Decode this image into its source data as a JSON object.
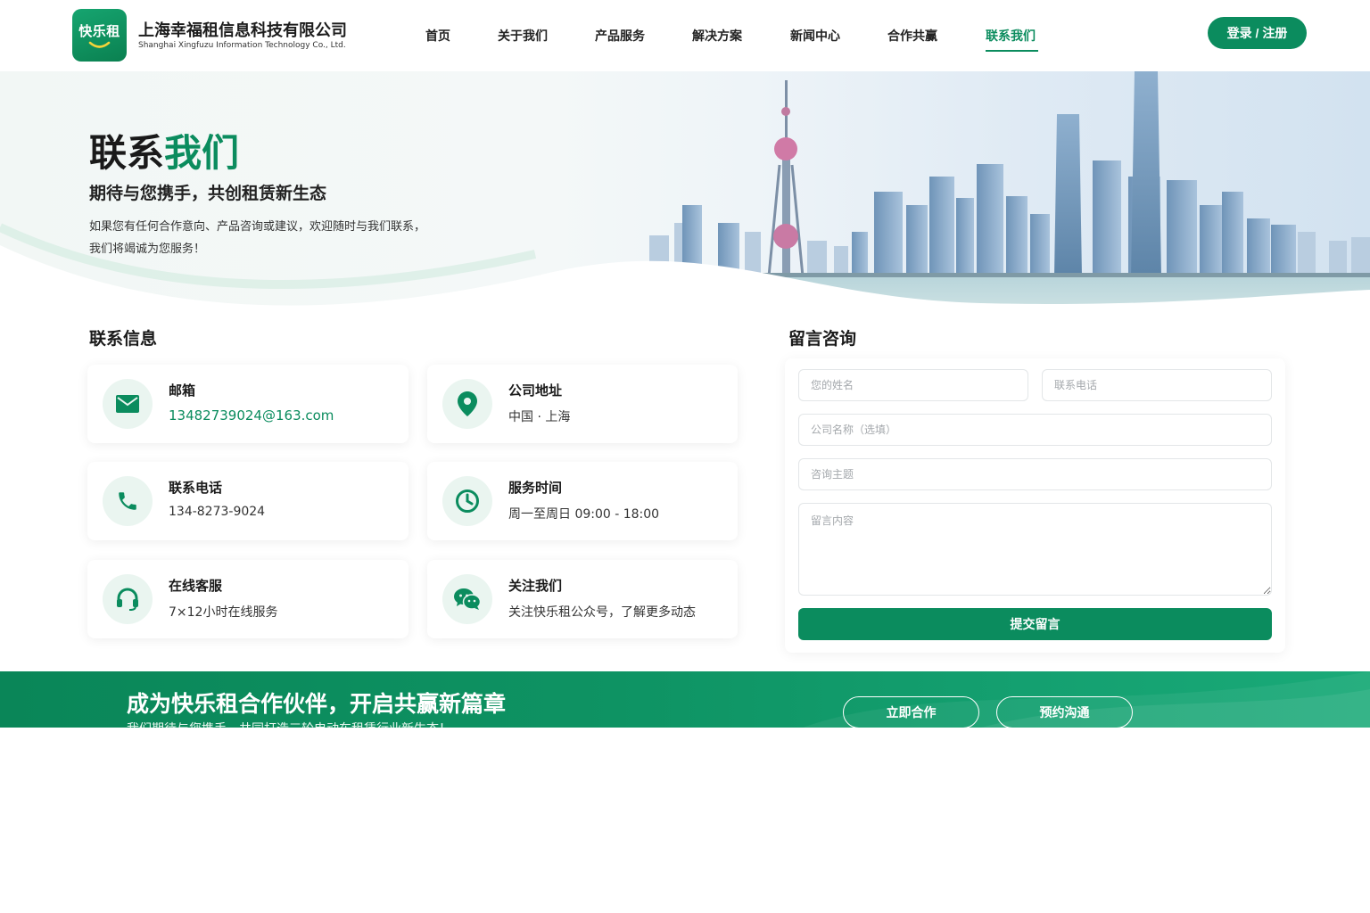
{
  "header": {
    "logo_text": "快乐租",
    "company_name_cn": "上海幸福租信息科技有限公司",
    "company_name_en": "Shanghai Xingfuzu Information Technology Co., Ltd.",
    "nav": [
      {
        "label": "首页",
        "active": false
      },
      {
        "label": "关于我们",
        "active": false
      },
      {
        "label": "产品服务",
        "active": false
      },
      {
        "label": "解决方案",
        "active": false
      },
      {
        "label": "新闻中心",
        "active": false
      },
      {
        "label": "合作共赢",
        "active": false
      },
      {
        "label": "联系我们",
        "active": true
      }
    ],
    "login_label": "登录 / 注册"
  },
  "hero": {
    "title_part1": "联系",
    "title_part2": "我们",
    "subtitle": "期待与您携手，共创租赁新生态",
    "desc_line1": "如果您有任何合作意向、产品咨询或建议，欢迎随时与我们联系，",
    "desc_line2": "我们将竭诚为您服务！"
  },
  "contact": {
    "section_title": "联系信息",
    "cards": [
      {
        "icon": "mail-icon",
        "label": "邮箱",
        "value": "13482739024@163.com"
      },
      {
        "icon": "location-pin-icon",
        "label": "公司地址",
        "value": "中国 · 上海"
      },
      {
        "icon": "phone-icon",
        "label": "联系电话",
        "value": "134-8273-9024"
      },
      {
        "icon": "clock-icon",
        "label": "服务时间",
        "value": "周一至周日 09:00 - 18:00"
      },
      {
        "icon": "headset-icon",
        "label": "在线客服",
        "value": "7×12小时在线服务"
      },
      {
        "icon": "wechat-icon",
        "label": "关注我们",
        "value": "关注快乐租公众号，了解更多动态"
      }
    ]
  },
  "form": {
    "section_title": "留言咨询",
    "name_placeholder": "您的姓名",
    "phone_placeholder": "联系电话",
    "company_placeholder": "公司名称（选填）",
    "subject_placeholder": "咨询主题",
    "message_placeholder": "留言内容",
    "submit_label": "提交留言"
  },
  "cta": {
    "title": "成为快乐租合作伙伴，开启共赢新篇章",
    "subtitle": "我们期待与您携手，共同打造三轮电动车租赁行业新生态！",
    "primary_label": "立即合作",
    "secondary_label": "预约沟通"
  },
  "colors": {
    "brand_green": "#0b8c5e",
    "icon_bg": "#eaf5f0",
    "text_dark": "#1a1a1a"
  }
}
